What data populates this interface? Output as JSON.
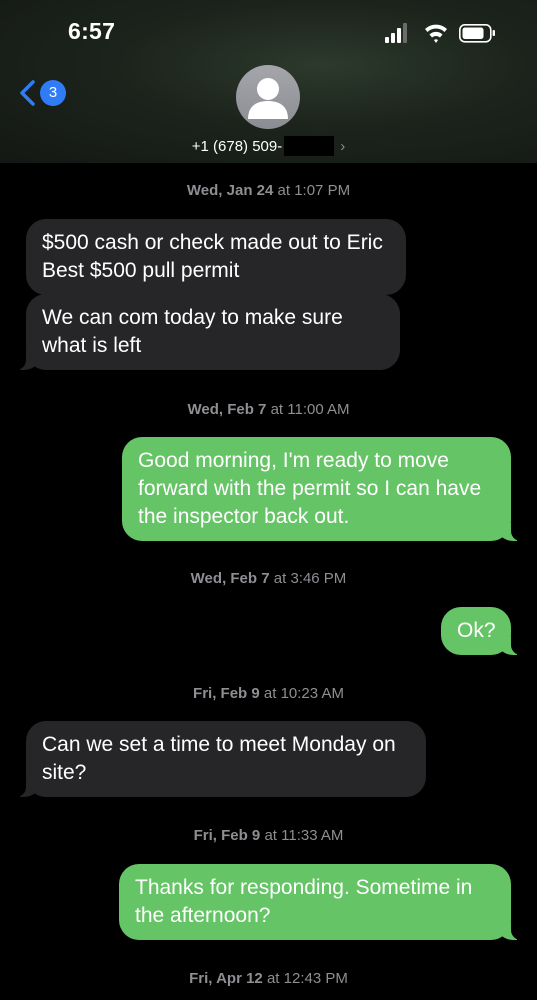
{
  "status_bar": {
    "time": "6:57"
  },
  "nav": {
    "back_badge": "3"
  },
  "contact": {
    "number": "+1 (678) 509-"
  },
  "messages": [
    {
      "type": "timestamp",
      "day": "Wed, Jan 24",
      "at": "at",
      "time": "1:07 PM"
    },
    {
      "type": "incoming",
      "text": "$500 cash or check made out to Eric Best $500 pull permit"
    },
    {
      "type": "incoming",
      "text": "We can com today to make sure what is left"
    },
    {
      "type": "timestamp",
      "day": "Wed, Feb 7",
      "at": "at",
      "time": "11:00 AM"
    },
    {
      "type": "outgoing",
      "text": "Good morning, I'm ready to move forward with the permit so I can have the inspector back out."
    },
    {
      "type": "timestamp",
      "day": "Wed, Feb 7",
      "at": "at",
      "time": "3:46 PM"
    },
    {
      "type": "outgoing",
      "text": "Ok?"
    },
    {
      "type": "timestamp",
      "day": "Fri, Feb 9",
      "at": "at",
      "time": "10:23 AM"
    },
    {
      "type": "incoming",
      "text": "Can we set a time to meet Monday on site?"
    },
    {
      "type": "timestamp",
      "day": "Fri, Feb 9",
      "at": "at",
      "time": "11:33 AM"
    },
    {
      "type": "outgoing",
      "text": "Thanks for responding. Sometime in the afternoon?"
    },
    {
      "type": "timestamp",
      "day": "Fri, Apr 12",
      "at": "at",
      "time": "12:43 PM"
    }
  ],
  "colors": {
    "incoming_bubble": "#262628",
    "outgoing_bubble": "#65c466",
    "badge": "#2f7cf6",
    "timestamp": "#8e8e93"
  },
  "icons": [
    "signal-icon",
    "wifi-icon",
    "battery-icon",
    "back-chevron-icon",
    "avatar-person-icon",
    "chevron-right-icon"
  ]
}
